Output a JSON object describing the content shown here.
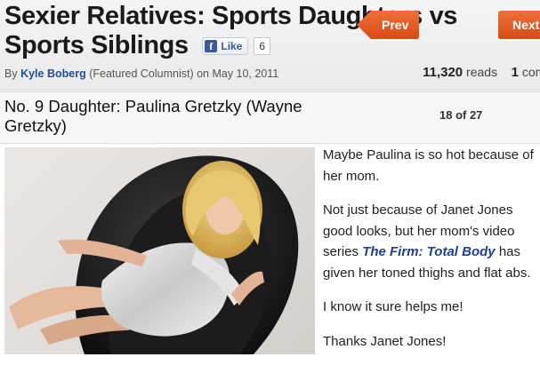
{
  "article": {
    "title": "Sexier Relatives: Sports Daughters vs Sports Siblings",
    "like_label": "Like",
    "like_icon": "facebook-icon",
    "like_count": "6",
    "byline_prefix": "By",
    "author": "Kyle Boberg",
    "byline_suffix": "(Featured Columnist) on May 10, 2011",
    "reads_count": "11,320",
    "reads_label": "reads",
    "comments_count": "1",
    "comments_label": "comm"
  },
  "slide": {
    "title": "No. 9 Daughter: Paulina Gretzky (Wayne Gretzky)",
    "prev_label": "Prev",
    "next_label": "Next",
    "counter": "18 of 27",
    "accent_color": "#e5561f"
  },
  "body": {
    "p1": "Maybe Paulina is so hot because of her mom.",
    "p2_before": "Not just because of Janet Jones good looks, but her mom's video series",
    "p2_link": "The Firm: Total Body",
    "p2_after": "has given her toned thighs and flat abs.",
    "p3": "I know it sure helps me!",
    "p4": "Thanks Janet Jones!"
  }
}
